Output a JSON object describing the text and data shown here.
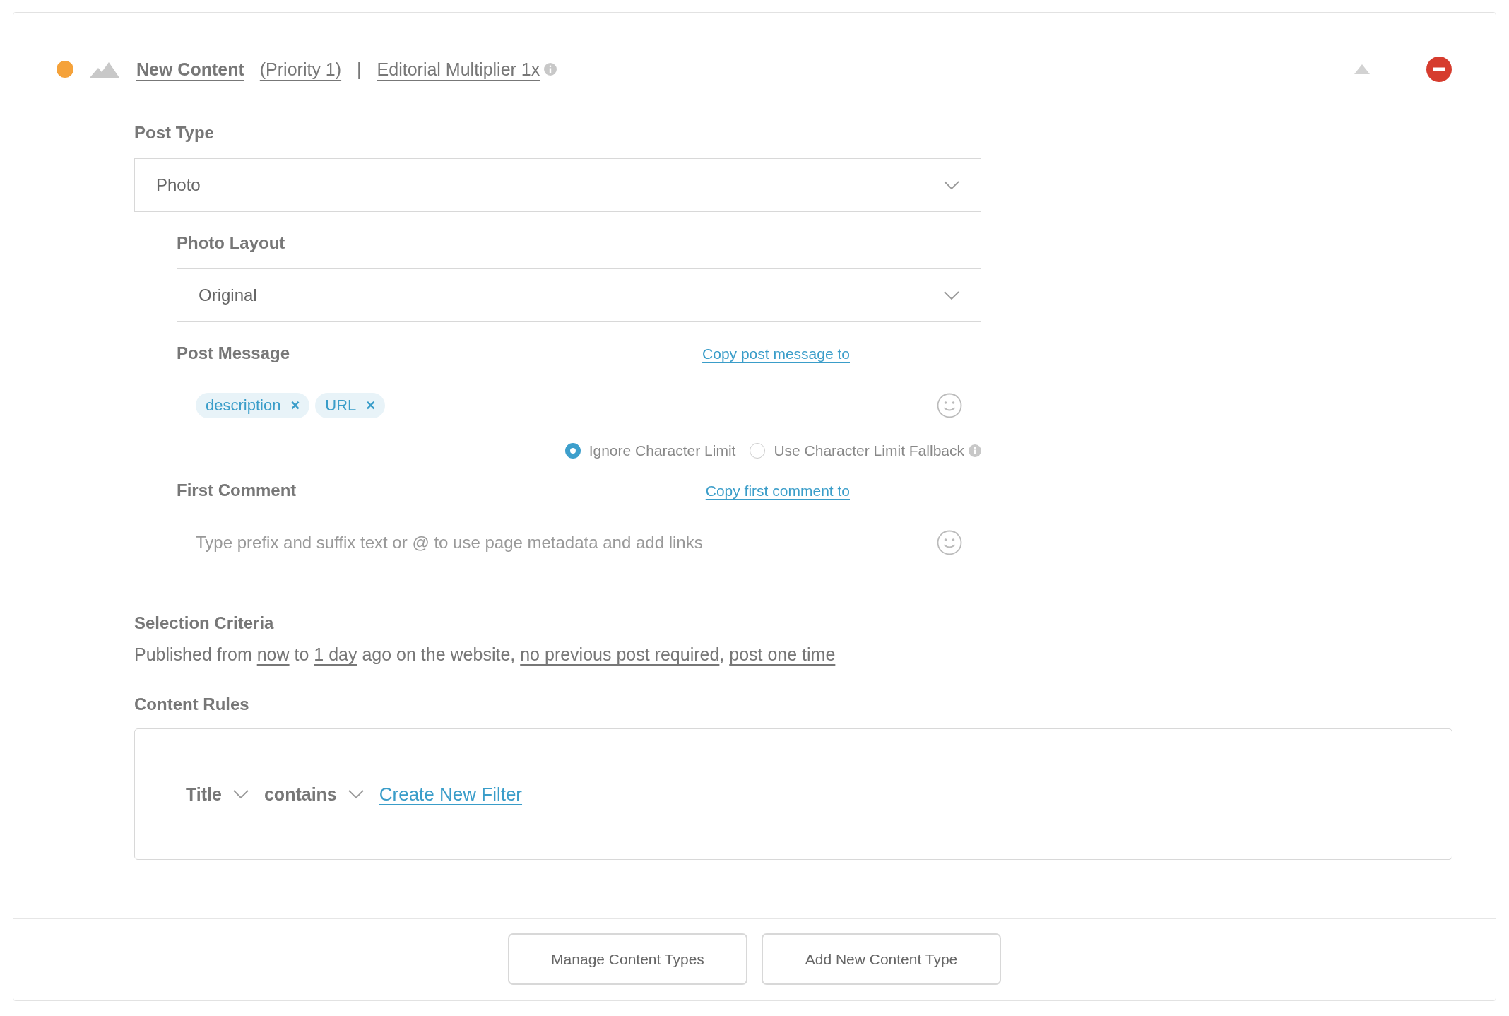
{
  "header": {
    "title": "New Content",
    "priority": "(Priority 1)",
    "separator": "|",
    "multiplier": "Editorial Multiplier 1x"
  },
  "post_type": {
    "label": "Post Type",
    "value": "Photo"
  },
  "photo_layout": {
    "label": "Photo Layout",
    "value": "Original"
  },
  "post_message": {
    "label": "Post Message",
    "copy_link": "Copy post message to",
    "tags": [
      {
        "text": "description",
        "remove": "×"
      },
      {
        "text": "URL",
        "remove": "×"
      }
    ],
    "options": [
      {
        "label": "Ignore Character Limit",
        "selected": true
      },
      {
        "label": "Use Character Limit Fallback",
        "selected": false
      }
    ]
  },
  "first_comment": {
    "label": "First Comment",
    "copy_link": "Copy first comment to",
    "placeholder": "Type prefix and suffix text or @ to use page metadata and add links"
  },
  "selection_criteria": {
    "label": "Selection Criteria",
    "sentence": [
      {
        "kind": "text",
        "text": "Published from "
      },
      {
        "kind": "link",
        "text": "now"
      },
      {
        "kind": "text",
        "text": " to "
      },
      {
        "kind": "link",
        "text": "1 day"
      },
      {
        "kind": "text",
        "text": " ago on the website, "
      },
      {
        "kind": "link",
        "text": "no previous post required"
      },
      {
        "kind": "text",
        "text": ", "
      },
      {
        "kind": "link",
        "text": "post one time"
      }
    ]
  },
  "content_rules": {
    "label": "Content Rules",
    "field": "Title",
    "operator": "contains",
    "action": "Create New Filter"
  },
  "buttons": [
    "Manage Content Types",
    "Add New Content Type"
  ]
}
